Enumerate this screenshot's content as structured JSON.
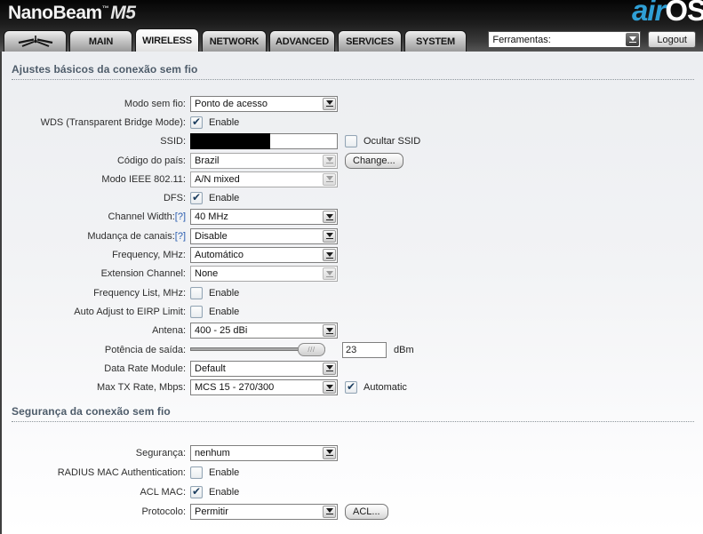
{
  "colors": {
    "accent_blue": "#2f9fd5",
    "help_link": "#2a5db0",
    "section_title": "#4e5c6a"
  },
  "header": {
    "brand": "NanoBeam",
    "brand_tm": "™",
    "brand_model": "M5",
    "logo_air": "air",
    "logo_os": "OS",
    "tools_label": "Ferramentas:",
    "logout_label": "Logout",
    "tabs": [
      {
        "label": "MAIN",
        "active": false
      },
      {
        "label": "WIRELESS",
        "active": true
      },
      {
        "label": "NETWORK",
        "active": false
      },
      {
        "label": "ADVANCED",
        "active": false
      },
      {
        "label": "SERVICES",
        "active": false
      },
      {
        "label": "SYSTEM",
        "active": false
      }
    ]
  },
  "wireless": {
    "title": "Ajustes básicos da conexão sem fio",
    "modo_sem_fio": {
      "label": "Modo sem fio:",
      "value": "Ponto de acesso"
    },
    "wds": {
      "label": "WDS (Transparent Bridge Mode):",
      "checkbox_label": "Enable",
      "checked": true
    },
    "ssid": {
      "label": "SSID:",
      "value": "",
      "redacted": true,
      "hide_label": "Ocultar SSID",
      "hide_checked": false
    },
    "country": {
      "label": "Código do país:",
      "value": "Brazil",
      "disabled": true,
      "button_label": "Change..."
    },
    "ieee_mode": {
      "label": "Modo IEEE 802.11:",
      "value": "A/N mixed",
      "disabled": true
    },
    "dfs": {
      "label": "DFS:",
      "checkbox_label": "Enable",
      "checked": true
    },
    "channel_width": {
      "label": "Channel Width:",
      "help": "[?]",
      "value": "40 MHz"
    },
    "channel_shifting": {
      "label": "Mudança de canais:",
      "help": "[?]",
      "value": "Disable"
    },
    "frequency": {
      "label": "Frequency, MHz:",
      "value": "Automático"
    },
    "extension_channel": {
      "label": "Extension Channel:",
      "value": "None",
      "disabled": true
    },
    "frequency_list": {
      "label": "Frequency List, MHz:",
      "checkbox_label": "Enable",
      "checked": false
    },
    "eirp": {
      "label": "Auto Adjust to EIRP Limit:",
      "checkbox_label": "Enable",
      "checked": false
    },
    "antenna": {
      "label": "Antena:",
      "value": "400 - 25 dBi"
    },
    "output_power": {
      "label": "Potência de saída:",
      "value": "23",
      "unit": "dBm"
    },
    "data_rate_module": {
      "label": "Data Rate Module:",
      "value": "Default"
    },
    "max_tx_rate": {
      "label": "Max TX Rate, Mbps:",
      "value": "MCS 15 - 270/300",
      "checkbox_label": "Automatic",
      "checked": true
    }
  },
  "security": {
    "title": "Segurança da conexão sem fio",
    "security_mode": {
      "label": "Segurança:",
      "value": "nenhum"
    },
    "radius_mac": {
      "label": "RADIUS MAC Authentication:",
      "checkbox_label": "Enable",
      "checked": false
    },
    "acl_mac": {
      "label": "ACL MAC:",
      "checkbox_label": "Enable",
      "checked": true
    },
    "protocol": {
      "label": "Protocolo:",
      "value": "Permitir",
      "button_label": "ACL..."
    }
  }
}
